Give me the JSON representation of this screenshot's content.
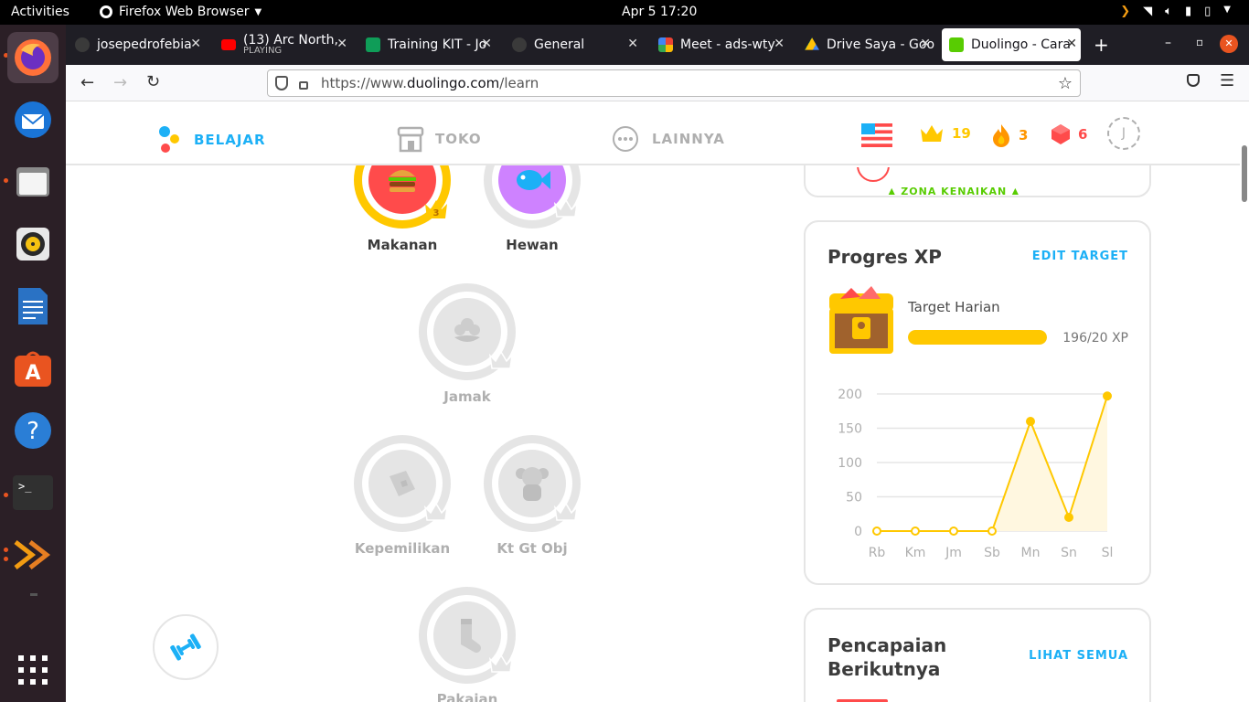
{
  "system": {
    "activities": "Activities",
    "app_menu": "Firefox Web Browser",
    "clock": "Apr 5  17:20"
  },
  "tabs": [
    {
      "title": "josepedrofebia",
      "sub": ""
    },
    {
      "title": "(13) Arc North,",
      "sub": "PLAYING"
    },
    {
      "title": "Training KIT - Jo",
      "sub": ""
    },
    {
      "title": "General",
      "sub": ""
    },
    {
      "title": "Meet - ads-wty",
      "sub": ""
    },
    {
      "title": "Drive Saya - Goo",
      "sub": ""
    },
    {
      "title": "Duolingo - Cara",
      "sub": ""
    }
  ],
  "url": {
    "prefix": "https://www.",
    "host": "duolingo.com",
    "path": "/learn"
  },
  "nav": {
    "learn": "BELAJAR",
    "shop": "TOKO",
    "more": "LAINNYA",
    "crowns": "19",
    "streak": "3",
    "gems": "6",
    "avatar_letter": "J"
  },
  "skills": {
    "food": {
      "label": "Makanan",
      "level": "3"
    },
    "animals": {
      "label": "Hewan"
    },
    "plural": {
      "label": "Jamak"
    },
    "possessive": {
      "label": "Kepemilikan"
    },
    "obj_pronouns": {
      "label": "Kt Gt Obj"
    },
    "clothing": {
      "label": "Pakaian"
    }
  },
  "league": {
    "promotion_zone": "ZONA KENAIKAN"
  },
  "xp_progress": {
    "title": "Progres XP",
    "edit_target": "EDIT TARGET",
    "daily_target": "Target Harian",
    "progress_text": "196/20 XP",
    "progress_fraction": 1.0
  },
  "achievements": {
    "title_line1": "Pencapaian",
    "title_line2": "Berikutnya",
    "see_all": "LIHAT SEMUA"
  },
  "chart_data": {
    "type": "line",
    "categories": [
      "Rb",
      "Km",
      "Jm",
      "Sb",
      "Mn",
      "Sn",
      "Sl"
    ],
    "values": [
      0,
      0,
      0,
      0,
      160,
      20,
      197
    ],
    "y_ticks": [
      "0",
      "50",
      "100",
      "150",
      "200"
    ],
    "ylim": [
      0,
      200
    ],
    "grid": true,
    "color": "#ffc800",
    "fill": "#fff7e0"
  },
  "colors": {
    "blue": "#1cb0f6",
    "grey": "#afafaf",
    "gold": "#ffc800",
    "orange": "#ff9600",
    "red": "#ff4b4b"
  }
}
